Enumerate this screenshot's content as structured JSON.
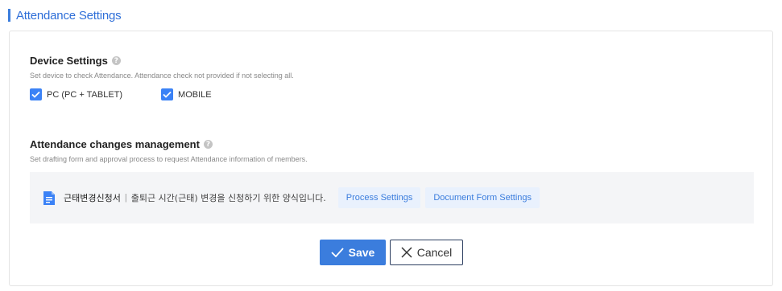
{
  "header": {
    "title": "Attendance Settings"
  },
  "device_settings": {
    "title": "Device Settings",
    "help": "?",
    "description": "Set device to check Attendance. Attendance check not provided if not selecting all.",
    "options": [
      {
        "label": "PC (PC + TABLET)",
        "checked": true
      },
      {
        "label": "MOBILE",
        "checked": true
      }
    ]
  },
  "changes_management": {
    "title": "Attendance changes management",
    "help": "?",
    "description": "Set drafting form and approval process to request Attendance information of members.",
    "form": {
      "name": "근태변경신청서",
      "separator": "|",
      "description": "출퇴근 시간(근태) 변경을 신청하기 위한 양식입니다.",
      "process_settings_label": "Process Settings",
      "document_form_settings_label": "Document Form Settings"
    }
  },
  "actions": {
    "save_label": "Save",
    "cancel_label": "Cancel"
  },
  "colors": {
    "accent": "#3b7ddd",
    "checkbox": "#3b82f6",
    "form_box_bg": "#f4f5f7"
  }
}
